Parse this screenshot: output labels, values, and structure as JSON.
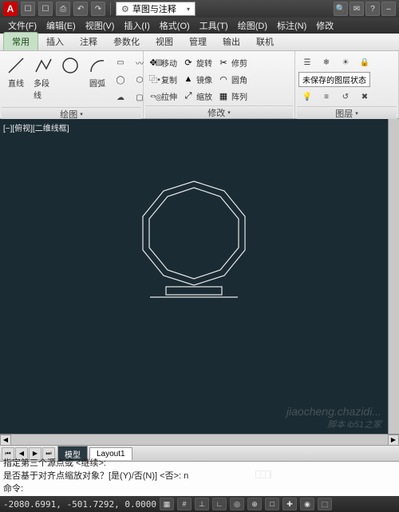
{
  "app_icon_letter": "A",
  "qat": [
    "☐",
    "☐",
    "⎙",
    "↶",
    "↷"
  ],
  "workspace": {
    "icon": "⚙",
    "label": "草图与注释",
    "dd": "▾"
  },
  "title_right_icons": [
    "🔍",
    "✉",
    "?",
    "–"
  ],
  "menu": [
    "文件(F)",
    "编辑(E)",
    "视图(V)",
    "插入(I)",
    "格式(O)",
    "工具(T)",
    "绘图(D)",
    "标注(N)",
    "修改"
  ],
  "ribbon_tabs": [
    "常用",
    "插入",
    "注释",
    "参数化",
    "视图",
    "管理",
    "输出",
    "联机"
  ],
  "active_ribbon_tab": 0,
  "panel_draw": {
    "title": "绘图",
    "dd": "▾",
    "line": "直线",
    "polyline": "多段线",
    "arc": "圆弧"
  },
  "panel_modify": {
    "title": "修改",
    "dd": "▾",
    "move": {
      "icon": "✥",
      "label": "移动"
    },
    "rotate": {
      "icon": "⟳",
      "label": "旋转"
    },
    "trim": {
      "icon": "✂",
      "label": "修剪"
    },
    "copy": {
      "icon": "⿻",
      "label": "复制"
    },
    "mirror": {
      "icon": "▲",
      "label": "镜像"
    },
    "fillet": {
      "icon": "◠",
      "label": "圆角"
    },
    "stretch": {
      "icon": "⇔",
      "label": "拉伸"
    },
    "scale": {
      "icon": "⤢",
      "label": "缩放"
    },
    "array": {
      "icon": "▦",
      "label": "阵列"
    }
  },
  "panel_layers": {
    "title": "图层",
    "dd": "▾",
    "unsaved": "未保存的图层状态"
  },
  "canvas": {
    "view_label": "[−][俯视][二维线框]"
  },
  "watermark": "jiaocheng.chazidi...",
  "watermark2": "脚本 ib51之家",
  "model_tabs": {
    "nav": [
      "⏮",
      "◀",
      "▶",
      "⏭"
    ],
    "tabs": [
      "模型",
      "Layout1"
    ],
    "active": 0
  },
  "cmd": {
    "line1": "指定第三个源点或 <继续>:",
    "line2": "是否基于对齐点缩放对象？[是(Y)/否(N)] <否>: n",
    "prompt": "命令:",
    "input": ""
  },
  "status": {
    "coords": "-2080.6991, -501.7292, 0.0000",
    "buttons": [
      "▦",
      "#",
      "⊥",
      "∟",
      "◎",
      "⊕",
      "□",
      "✚",
      "◉",
      "⬚"
    ]
  }
}
